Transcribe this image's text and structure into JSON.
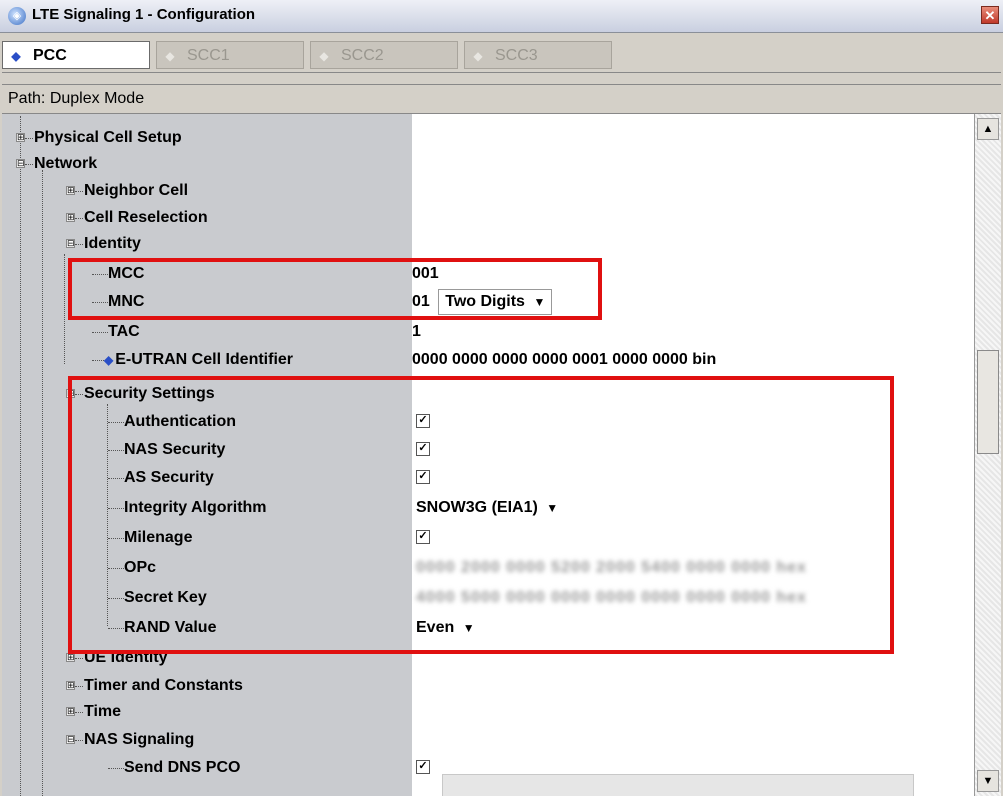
{
  "window": {
    "title": "LTE Signaling 1 - Configuration",
    "close_symbol": "✕"
  },
  "tabs": [
    {
      "label": "PCC",
      "active": true
    },
    {
      "label": "SCC1",
      "active": false
    },
    {
      "label": "SCC2",
      "active": false
    },
    {
      "label": "SCC3",
      "active": false
    }
  ],
  "path": {
    "label": "Path:",
    "value": "Duplex Mode"
  },
  "tree": {
    "physical_cell_setup": "Physical Cell Setup",
    "network": "Network",
    "neighbor_cell": "Neighbor Cell",
    "cell_reselection": "Cell Reselection",
    "identity": "Identity",
    "mcc": {
      "label": "MCC",
      "value": "001"
    },
    "mnc": {
      "label": "MNC",
      "value": "01",
      "option": "Two Digits"
    },
    "tac": {
      "label": "TAC",
      "value": "1"
    },
    "eutran": {
      "label": "E-UTRAN Cell Identifier",
      "value": "0000 0000 0000 0000 0001 0000 0000  bin"
    },
    "security_settings": "Security Settings",
    "authentication": {
      "label": "Authentication",
      "checked": true
    },
    "nas_security": {
      "label": "NAS Security",
      "checked": true
    },
    "as_security": {
      "label": "AS Security",
      "checked": true
    },
    "integrity_algorithm": {
      "label": "Integrity Algorithm",
      "value": "SNOW3G (EIA1)"
    },
    "milenage": {
      "label": "Milenage",
      "checked": true
    },
    "opc": {
      "label": "OPc",
      "value": "0000 2000 0000 5200 2000 5400 0000 0000  hex"
    },
    "secret_key": {
      "label": "Secret Key",
      "value": "4000 5000 0000 0000 0000 0000 0000 0000  hex"
    },
    "rand_value": {
      "label": "RAND Value",
      "value": "Even"
    },
    "ue_identity": "UE Identity",
    "timer_and_constants": "Timer and Constants",
    "time": "Time",
    "nas_signaling": "NAS Signaling",
    "send_dns_pco": {
      "label": "Send DNS PCO",
      "checked": true
    }
  },
  "colors": {
    "highlight_box": "#e01010",
    "selected_tab_diamond": "#2a4fc7",
    "tree_label_column": "#c9cbcf"
  },
  "icons": {
    "expanded": "⊟",
    "collapsed": "⊞",
    "check": "✓",
    "dropdown": "▼",
    "scroll_up": "▲",
    "scroll_down": "▼"
  }
}
